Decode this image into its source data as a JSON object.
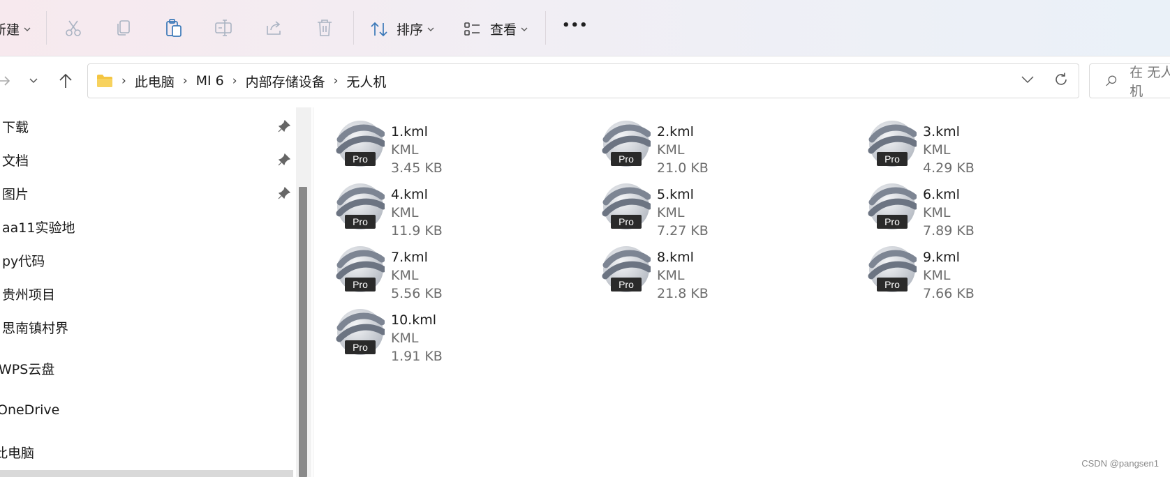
{
  "toolbar": {
    "new_label": "新建",
    "sort_label": "排序",
    "view_label": "查看",
    "more_label": "•••",
    "icons": [
      "cut-icon",
      "copy-icon",
      "paste-icon",
      "rename-icon",
      "share-icon",
      "delete-icon"
    ]
  },
  "address": {
    "crumbs": [
      "此电脑",
      "MI 6",
      "内部存储设备",
      "无人机"
    ],
    "search_placeholder": "在 无人机"
  },
  "sidebar": {
    "items": [
      {
        "label": "下载",
        "pinned": true
      },
      {
        "label": "文档",
        "pinned": true
      },
      {
        "label": "图片",
        "pinned": true
      },
      {
        "label": "aa11实验地",
        "pinned": false
      },
      {
        "label": "py代码",
        "pinned": false
      },
      {
        "label": "贵州项目",
        "pinned": false
      },
      {
        "label": "思南镇村界",
        "pinned": false
      },
      {
        "label": "WPS云盘",
        "pinned": false
      },
      {
        "label": "OneDrive",
        "pinned": false
      },
      {
        "label": "此电脑",
        "pinned": false
      }
    ]
  },
  "files": [
    {
      "name": "1.kml",
      "type": "KML",
      "size": "3.45 KB",
      "badge": "Pro"
    },
    {
      "name": "2.kml",
      "type": "KML",
      "size": "21.0 KB",
      "badge": "Pro"
    },
    {
      "name": "3.kml",
      "type": "KML",
      "size": "4.29 KB",
      "badge": "Pro"
    },
    {
      "name": "4.kml",
      "type": "KML",
      "size": "11.9 KB",
      "badge": "Pro"
    },
    {
      "name": "5.kml",
      "type": "KML",
      "size": "7.27 KB",
      "badge": "Pro"
    },
    {
      "name": "6.kml",
      "type": "KML",
      "size": "7.89 KB",
      "badge": "Pro"
    },
    {
      "name": "7.kml",
      "type": "KML",
      "size": "5.56 KB",
      "badge": "Pro"
    },
    {
      "name": "8.kml",
      "type": "KML",
      "size": "21.8 KB",
      "badge": "Pro"
    },
    {
      "name": "9.kml",
      "type": "KML",
      "size": "7.66 KB",
      "badge": "Pro"
    },
    {
      "name": "10.kml",
      "type": "KML",
      "size": "1.91 KB",
      "badge": "Pro"
    }
  ],
  "watermark": "CSDN @pangsen1",
  "colors": {
    "accent": "#0067c0",
    "folder": "#f4c541",
    "muted_text": "#6d6d6d"
  }
}
